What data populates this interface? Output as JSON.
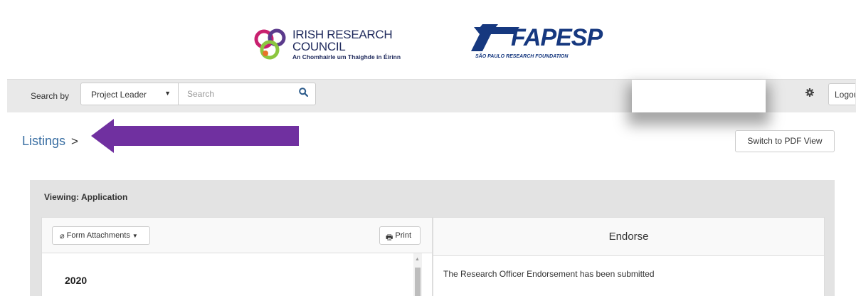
{
  "header": {
    "irc_title": "IRISH RESEARCH COUNCIL",
    "irc_subtitle": "An Chomhairle um Thaighde in Éirinn",
    "fapesp_name": "FAPESP",
    "fapesp_subtitle": "SÃO PAULO RESEARCH FOUNDATION"
  },
  "search": {
    "label": "Search by",
    "field_selected": "Project Leader",
    "placeholder": "Search"
  },
  "user_menu": {
    "logout_label": "Logout"
  },
  "breadcrumb": {
    "listings": "Listings",
    "separator": ">"
  },
  "actions": {
    "switch_pdf": "Switch to PDF View"
  },
  "viewing": {
    "title": "Viewing: Application",
    "form_attachments": "Form Attachments",
    "print": "Print",
    "year": "2020"
  },
  "endorse": {
    "title": "Endorse",
    "message": "The Research Officer Endorsement has been submitted"
  },
  "colors": {
    "accent_arrow": "#7030a0",
    "link": "#3a6fa3",
    "panel_bg": "#e3e3e3"
  }
}
